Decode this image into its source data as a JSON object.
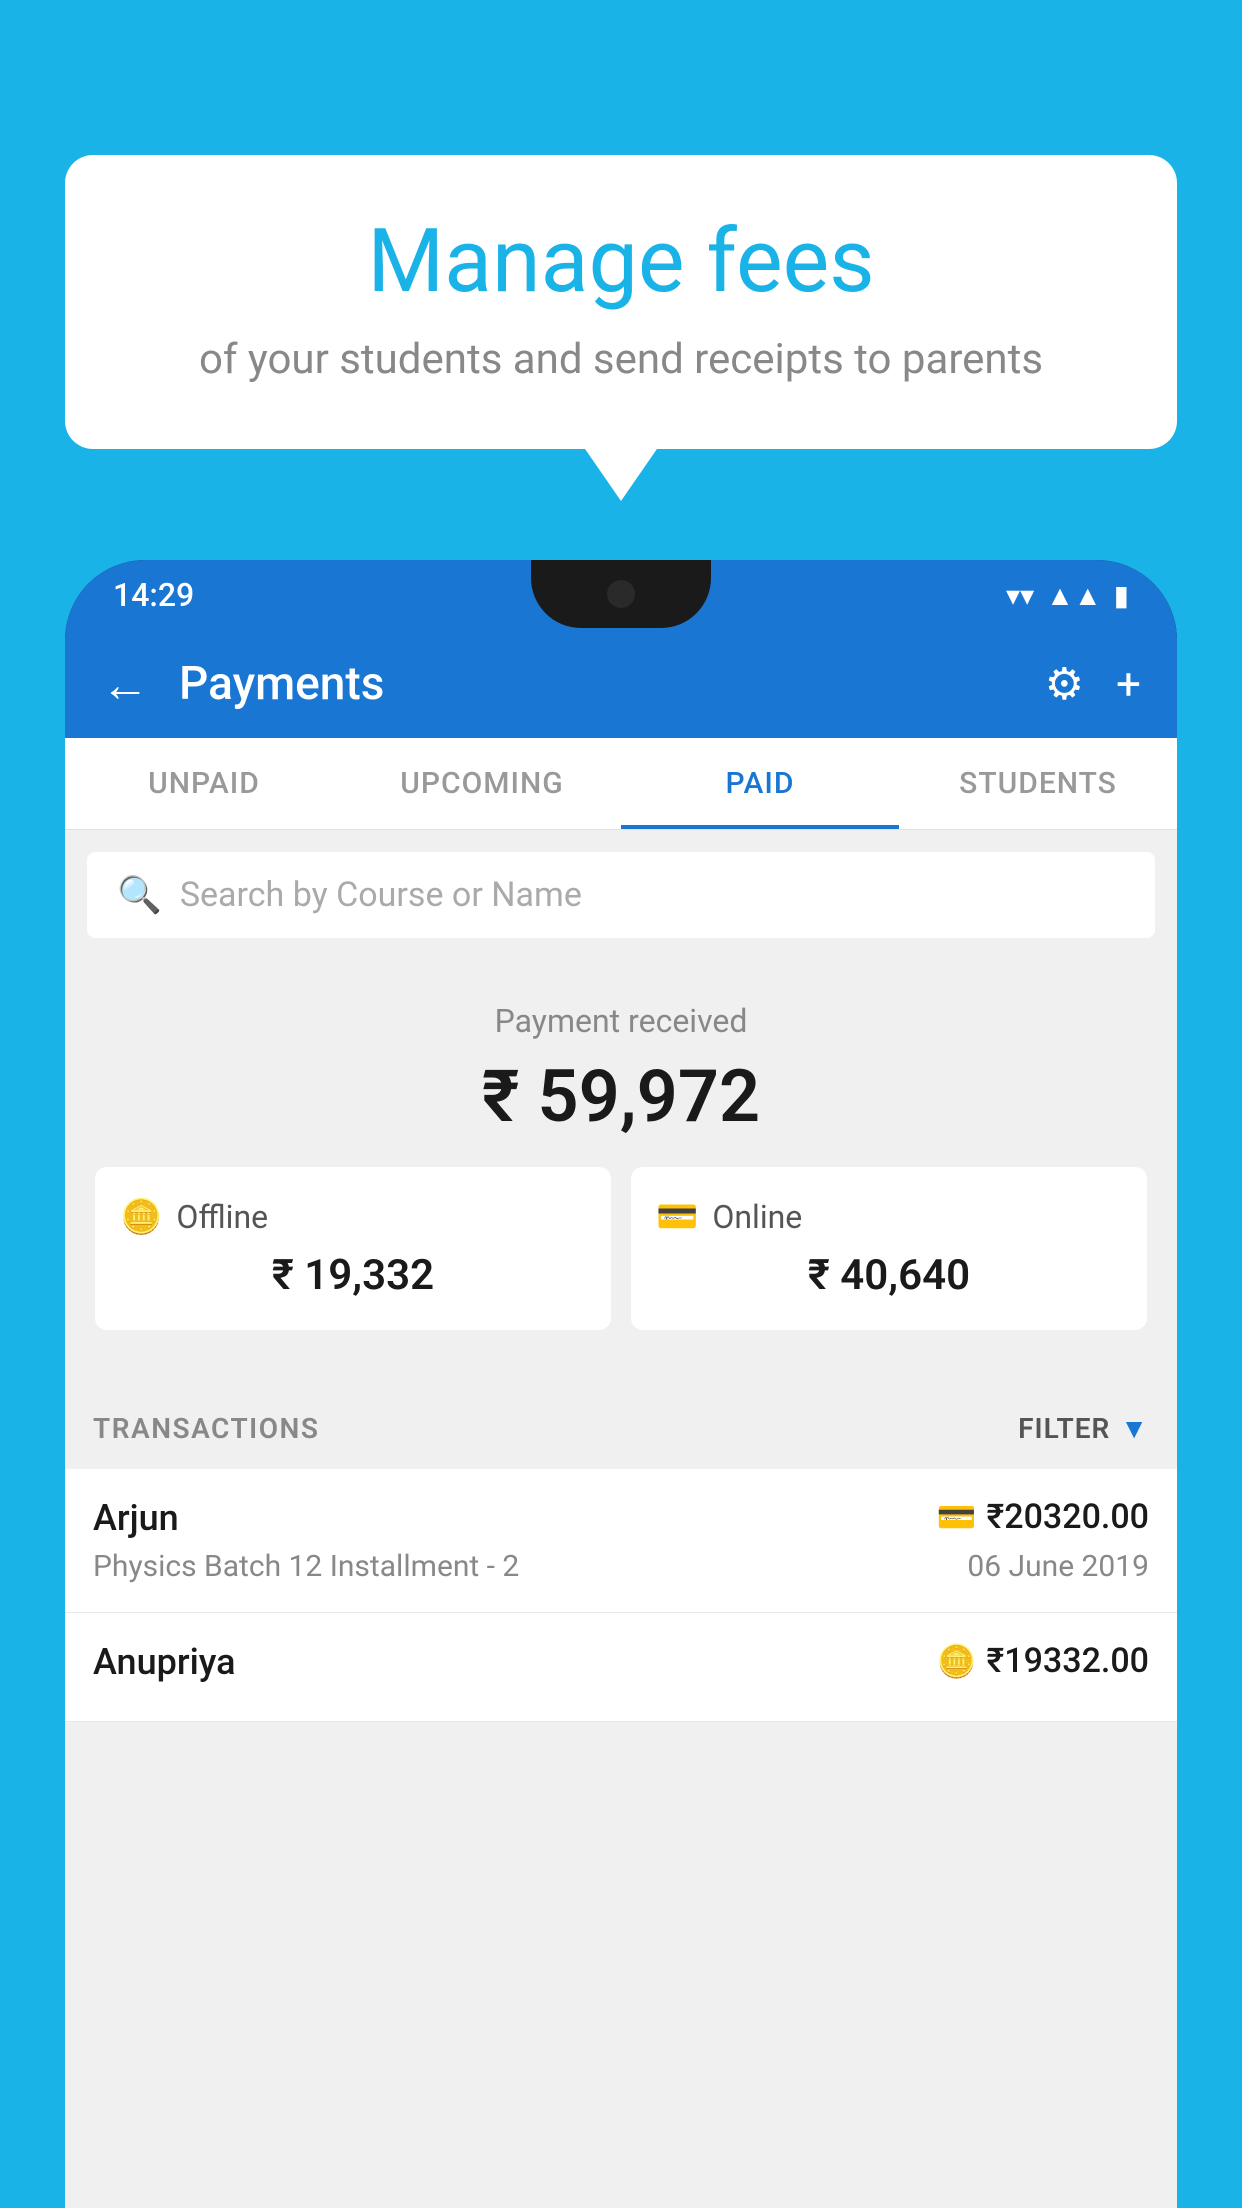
{
  "background_color": "#1ab3e8",
  "speech_bubble": {
    "title": "Manage fees",
    "subtitle": "of your students and send receipts to parents"
  },
  "status_bar": {
    "time": "14:29",
    "icons": [
      "wifi",
      "signal",
      "battery"
    ]
  },
  "app_bar": {
    "title": "Payments",
    "back_icon": "←",
    "settings_icon": "⚙",
    "add_icon": "+"
  },
  "tabs": [
    {
      "label": "UNPAID",
      "active": false
    },
    {
      "label": "UPCOMING",
      "active": false
    },
    {
      "label": "PAID",
      "active": true
    },
    {
      "label": "STUDENTS",
      "active": false
    }
  ],
  "search": {
    "placeholder": "Search by Course or Name"
  },
  "payment_summary": {
    "label": "Payment received",
    "total": "₹ 59,972",
    "offline": {
      "label": "Offline",
      "amount": "₹ 19,332"
    },
    "online": {
      "label": "Online",
      "amount": "₹ 40,640"
    }
  },
  "transactions": {
    "header_label": "TRANSACTIONS",
    "filter_label": "FILTER",
    "items": [
      {
        "name": "Arjun",
        "course": "Physics Batch 12 Installment - 2",
        "amount": "₹20320.00",
        "date": "06 June 2019",
        "payment_type": "online"
      },
      {
        "name": "Anupriya",
        "course": "",
        "amount": "₹19332.00",
        "date": "",
        "payment_type": "offline"
      }
    ]
  }
}
